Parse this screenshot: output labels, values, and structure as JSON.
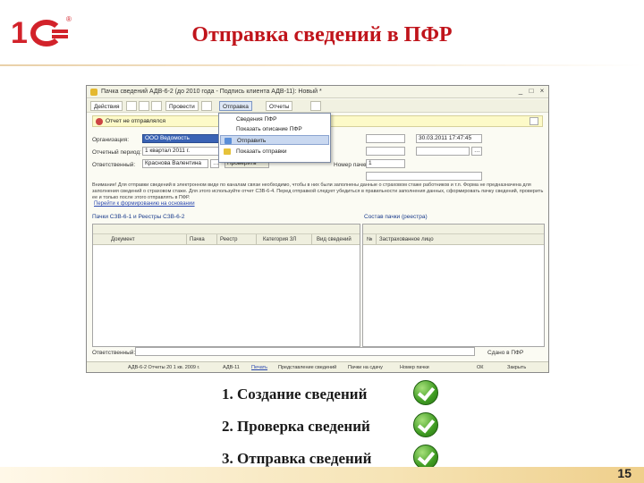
{
  "slide": {
    "title": "Отправка сведений в ПФР",
    "page_number": "15",
    "brand_color": "#c0141b",
    "steps": [
      {
        "label": "1. Создание сведений",
        "status": "check-icon"
      },
      {
        "label": "2. Проверка сведений",
        "status": "check-icon"
      },
      {
        "label": "3. Отправка сведений",
        "status": "check-icon"
      }
    ]
  },
  "window": {
    "title": "Пачка сведений АДВ-6-2 (до 2010 года - Подпись клиента АДВ-11): Новый *",
    "toolbar": {
      "actions": "Действия",
      "conduct": "Провести",
      "send": "Отправка",
      "reports": "Отчеты"
    },
    "infobar": "Отчет не отправлялся",
    "dropdown": {
      "items": [
        {
          "label": "Сведения ПФР"
        },
        {
          "label": "Показать описание ПФР"
        },
        {
          "label": "Отправить"
        },
        {
          "label": "Показать отправки"
        }
      ]
    },
    "form": {
      "org_label": "Организация:",
      "org_value": "ООО Ведомость",
      "period_label": "Отчетный период:",
      "period_value": "1 квартал 2011 г.",
      "person_label": "Ответственный:",
      "person_value": "Краснова Валентина",
      "check_label": "Проверить",
      "number_label": "Номер пачки:",
      "number_value": "1",
      "date_value": "30.03.2011 17:47:45"
    },
    "warning": "Внимание! Для отправки сведений в электронном виде по каналам связи необходимо, чтобы в них были заполнены данные о страховом стаже работников и т.п. Форма не предназначена для заполнения сведений о страховом стаже. Для этого используйте отчет СЗВ-6-4. Перед отправкой следует убедиться в правильности заполнения данных, сформировать пачку сведений, проверить ее и только после этого отправлять в ПФР.",
    "link": "Перейти к формированию на основании",
    "left_pane": {
      "title": "Пачки СЗВ-6-1 и Реестры СЗВ-6-2",
      "columns": [
        "Документ",
        "Пачка",
        "Реестр",
        "Категория ЗЛ",
        "Вид сведений"
      ]
    },
    "right_pane": {
      "title": "Состав пачки (реестра)",
      "columns": [
        "№",
        "Застрахованное лицо"
      ]
    },
    "responsible_label": "Ответственный:",
    "sent_label": "Сдано в ПФР",
    "status": [
      "АДВ-6-2 Отчеты 20 1 кв. 2009 г.",
      "АДВ-11",
      "Печать",
      "Представление сведений",
      "Пачки на сдачу",
      "Номер пачки",
      "ОК",
      "Закрыть"
    ]
  }
}
